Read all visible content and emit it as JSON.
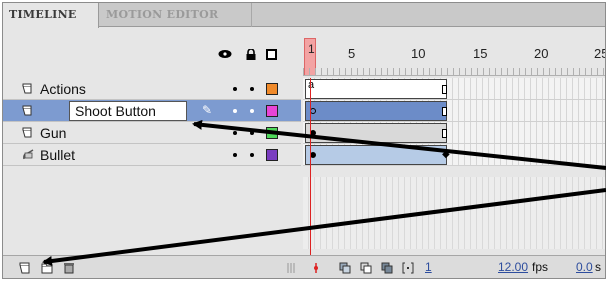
{
  "tabs": [
    {
      "label": "TIMELINE",
      "active": true
    },
    {
      "label": "MOTION EDITOR",
      "active": false
    }
  ],
  "header_icons": [
    "eye-icon",
    "lock-icon",
    "outline-icon"
  ],
  "ruler": {
    "playhead_label": "1",
    "labels": [
      "5",
      "10",
      "15",
      "20",
      "25"
    ]
  },
  "layers": [
    {
      "name": "Actions",
      "visible_dot": "•",
      "lock_dot": "•",
      "color": "#f08a2a",
      "icon": "layer-icon"
    },
    {
      "name": "Shoot Button",
      "visible_dot": "•",
      "lock_dot": "•",
      "color": "#e845d6",
      "icon": "layer-icon",
      "selected": true,
      "renaming": true
    },
    {
      "name": "Gun",
      "visible_dot": "•",
      "lock_dot": "•",
      "color": "#4ed85a",
      "icon": "layer-icon"
    },
    {
      "name": "Bullet",
      "visible_dot": "•",
      "lock_dot": "•",
      "color": "#7a3cc0",
      "icon": "guide-layer-icon"
    }
  ],
  "footer": {
    "current_frame": "1",
    "frame_rate": "12.00",
    "fps_label": "fps",
    "elapsed": "0.0",
    "elapsed_unit": "s"
  }
}
